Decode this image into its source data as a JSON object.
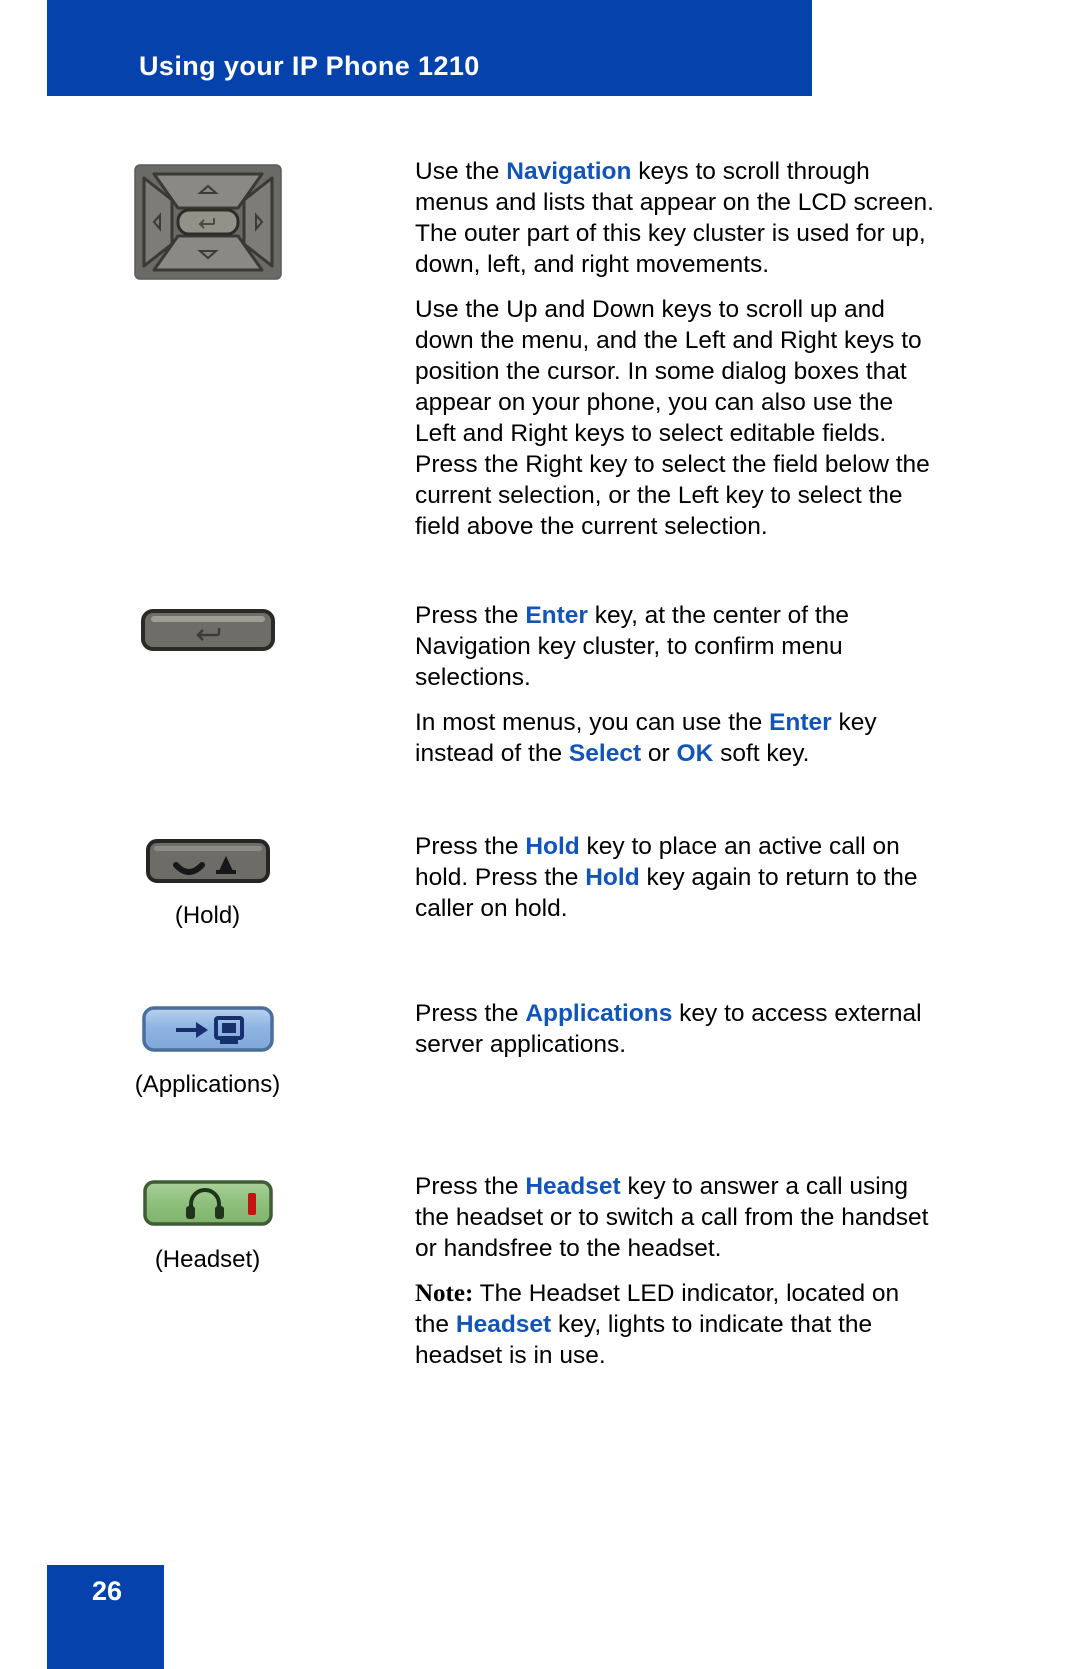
{
  "header": {
    "title": "Using your IP Phone 1210",
    "bar_color": "#0542ac",
    "text_color": "#ffffff"
  },
  "accent_color": "#1155bb",
  "footer": {
    "page_number": "26",
    "bar_color": "#0542ac"
  },
  "rows": [
    {
      "icon_name": "navigation-key-cluster-icon",
      "caption": "",
      "paragraphs": [
        {
          "segments": [
            {
              "text": "Use the ",
              "style": "normal"
            },
            {
              "text": "Navigation",
              "style": "keyword"
            },
            {
              "text": " keys to scroll through menus and lists that appear on the LCD screen. The outer part of this key cluster is used for up, down, left, and right movements.",
              "style": "normal"
            }
          ]
        },
        {
          "segments": [
            {
              "text": "Use the Up and Down keys to scroll up and down the menu, and the Left and Right keys to position the cursor. In some dialog boxes that appear on your phone, you can also use the Left and Right keys to select editable fields. Press the Right key to select the field below the current selection, or the Left key to select the field above the current selection.",
              "style": "normal"
            }
          ]
        }
      ]
    },
    {
      "icon_name": "enter-key-icon",
      "caption": "",
      "paragraphs": [
        {
          "segments": [
            {
              "text": "Press the ",
              "style": "normal"
            },
            {
              "text": "Enter",
              "style": "keyword"
            },
            {
              "text": " key, at the center of the Navigation key cluster, to confirm menu selections.",
              "style": "normal"
            }
          ]
        },
        {
          "segments": [
            {
              "text": "In most menus, you can use the ",
              "style": "normal"
            },
            {
              "text": "Enter",
              "style": "keyword"
            },
            {
              "text": " key instead of the ",
              "style": "normal"
            },
            {
              "text": "Select",
              "style": "keyword"
            },
            {
              "text": " or ",
              "style": "normal"
            },
            {
              "text": "OK",
              "style": "keyword"
            },
            {
              "text": " soft key.",
              "style": "normal"
            }
          ]
        }
      ]
    },
    {
      "icon_name": "hold-key-icon",
      "caption": "(Hold)",
      "paragraphs": [
        {
          "segments": [
            {
              "text": "Press the ",
              "style": "normal"
            },
            {
              "text": "Hold",
              "style": "keyword"
            },
            {
              "text": " key to place an active call on hold. Press the ",
              "style": "normal"
            },
            {
              "text": "Hold",
              "style": "keyword"
            },
            {
              "text": " key again to return to the caller on hold.",
              "style": "normal"
            }
          ]
        }
      ]
    },
    {
      "icon_name": "applications-key-icon",
      "caption": "(Applications)",
      "paragraphs": [
        {
          "segments": [
            {
              "text": "Press the ",
              "style": "normal"
            },
            {
              "text": "Applications",
              "style": "keyword"
            },
            {
              "text": " key to access external server applications.",
              "style": "normal"
            }
          ]
        }
      ]
    },
    {
      "icon_name": "headset-key-icon",
      "caption": "(Headset)",
      "paragraphs": [
        {
          "segments": [
            {
              "text": "Press the ",
              "style": "normal"
            },
            {
              "text": "Headset",
              "style": "keyword"
            },
            {
              "text": " key to answer a call using the headset or to switch a call from the handset or handsfree to the headset.",
              "style": "normal"
            }
          ]
        },
        {
          "segments": [
            {
              "text": "Note:",
              "style": "note"
            },
            {
              "text": " The Headset LED indicator, located on the ",
              "style": "normal"
            },
            {
              "text": "Headset",
              "style": "keyword"
            },
            {
              "text": " key, lights to indicate that the headset is in use.",
              "style": "normal"
            }
          ]
        }
      ]
    }
  ]
}
